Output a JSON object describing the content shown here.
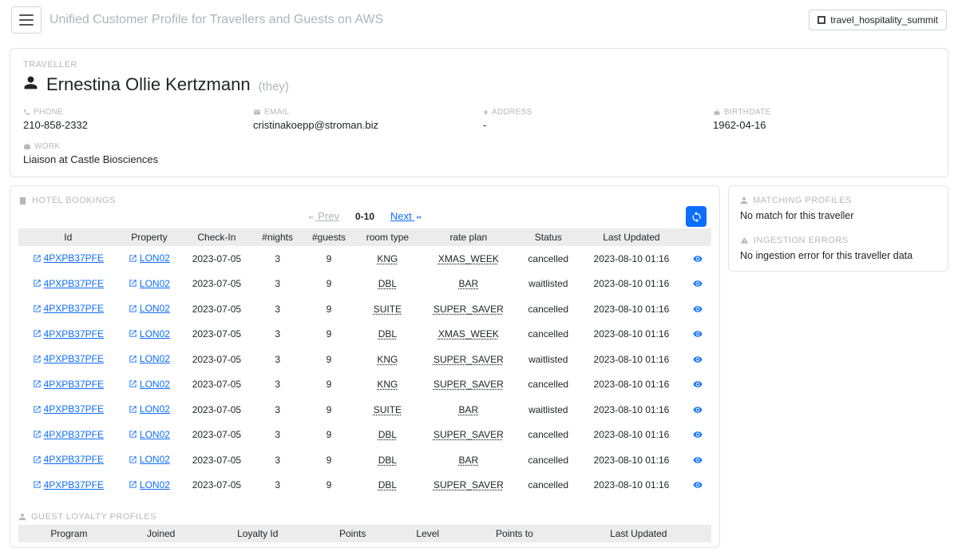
{
  "header": {
    "app_title": "Unified Customer Profile for Travellers and Guests on AWS",
    "domain": "travel_hospitality_summit"
  },
  "traveller": {
    "section_label": "TRAVELLER",
    "name": "Ernestina Ollie Kertzmann",
    "pronoun": "(they)",
    "fields": {
      "phone": {
        "label": "PHONE",
        "value": "210-858-2332"
      },
      "email": {
        "label": "EMAIL",
        "value": "cristinakoepp@stroman.biz"
      },
      "address": {
        "label": "ADDRESS",
        "value": "-"
      },
      "birthdate": {
        "label": "BIRTHDATE",
        "value": "1962-04-16"
      },
      "work": {
        "label": "WORK",
        "value": "Liaison at Castle Biosciences"
      }
    }
  },
  "bookings": {
    "section_label": "HOTEL BOOKINGS",
    "pager": {
      "prev": "Prev",
      "next": "Next",
      "range": "0-10"
    },
    "columns": [
      "Id",
      "Property",
      "Check-In",
      "#nights",
      "#guests",
      "room type",
      "rate plan",
      "Status",
      "Last Updated",
      ""
    ],
    "rows": [
      {
        "id": "4PXPB37PFE",
        "property": "LON02",
        "checkin": "2023-07-05",
        "nights": "3",
        "guests": "9",
        "room": "KNG",
        "rate": "XMAS_WEEK",
        "status": "cancelled",
        "updated": "2023-08-10 01:16"
      },
      {
        "id": "4PXPB37PFE",
        "property": "LON02",
        "checkin": "2023-07-05",
        "nights": "3",
        "guests": "9",
        "room": "DBL",
        "rate": "BAR",
        "status": "waitlisted",
        "updated": "2023-08-10 01:16"
      },
      {
        "id": "4PXPB37PFE",
        "property": "LON02",
        "checkin": "2023-07-05",
        "nights": "3",
        "guests": "9",
        "room": "SUITE",
        "rate": "SUPER_SAVER",
        "status": "cancelled",
        "updated": "2023-08-10 01:16"
      },
      {
        "id": "4PXPB37PFE",
        "property": "LON02",
        "checkin": "2023-07-05",
        "nights": "3",
        "guests": "9",
        "room": "DBL",
        "rate": "XMAS_WEEK",
        "status": "cancelled",
        "updated": "2023-08-10 01:16"
      },
      {
        "id": "4PXPB37PFE",
        "property": "LON02",
        "checkin": "2023-07-05",
        "nights": "3",
        "guests": "9",
        "room": "KNG",
        "rate": "SUPER_SAVER",
        "status": "waitlisted",
        "updated": "2023-08-10 01:16"
      },
      {
        "id": "4PXPB37PFE",
        "property": "LON02",
        "checkin": "2023-07-05",
        "nights": "3",
        "guests": "9",
        "room": "KNG",
        "rate": "SUPER_SAVER",
        "status": "cancelled",
        "updated": "2023-08-10 01:16"
      },
      {
        "id": "4PXPB37PFE",
        "property": "LON02",
        "checkin": "2023-07-05",
        "nights": "3",
        "guests": "9",
        "room": "SUITE",
        "rate": "BAR",
        "status": "waitlisted",
        "updated": "2023-08-10 01:16"
      },
      {
        "id": "4PXPB37PFE",
        "property": "LON02",
        "checkin": "2023-07-05",
        "nights": "3",
        "guests": "9",
        "room": "DBL",
        "rate": "SUPER_SAVER",
        "status": "cancelled",
        "updated": "2023-08-10 01:16"
      },
      {
        "id": "4PXPB37PFE",
        "property": "LON02",
        "checkin": "2023-07-05",
        "nights": "3",
        "guests": "9",
        "room": "DBL",
        "rate": "BAR",
        "status": "cancelled",
        "updated": "2023-08-10 01:16"
      },
      {
        "id": "4PXPB37PFE",
        "property": "LON02",
        "checkin": "2023-07-05",
        "nights": "3",
        "guests": "9",
        "room": "DBL",
        "rate": "SUPER_SAVER",
        "status": "cancelled",
        "updated": "2023-08-10 01:16"
      }
    ]
  },
  "loyalty": {
    "section_label": "GUEST LOYALTY PROFILES",
    "columns": [
      "Program",
      "Joined",
      "Loyalty Id",
      "Points",
      "Level",
      "Points to",
      "Last Updated"
    ]
  },
  "sidebar": {
    "matching": {
      "label": "MATCHING PROFILES",
      "text": "No match for this traveller"
    },
    "errors": {
      "label": "INGESTION ERRORS",
      "text": "No ingestion error for this traveller data"
    }
  }
}
